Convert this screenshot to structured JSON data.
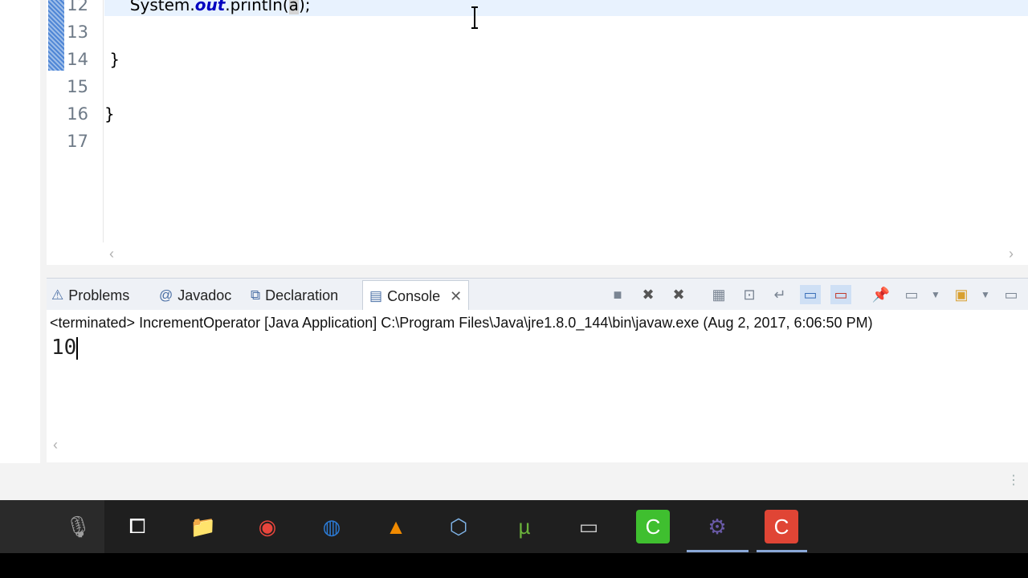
{
  "editor": {
    "lines": [
      {
        "num": "12",
        "parts": [
          {
            "t": "System.",
            "c": ""
          },
          {
            "t": "out",
            "c": "field"
          },
          {
            "t": ".println(",
            "c": ""
          },
          {
            "t": "a",
            "c": "hl"
          },
          {
            "t": ");",
            "c": ""
          }
        ],
        "indent": "     "
      },
      {
        "num": "13",
        "parts": [],
        "indent": ""
      },
      {
        "num": "14",
        "parts": [
          {
            "t": "}",
            "c": ""
          }
        ],
        "indent": " "
      },
      {
        "num": "15",
        "parts": [],
        "indent": ""
      },
      {
        "num": "16",
        "parts": [
          {
            "t": "}",
            "c": ""
          }
        ],
        "indent": ""
      },
      {
        "num": "17",
        "parts": [],
        "indent": ""
      }
    ]
  },
  "console": {
    "tabs": [
      {
        "label": "Problems",
        "icon": "problems-icon",
        "glyph": "⚠"
      },
      {
        "label": "Javadoc",
        "icon": "at-icon",
        "glyph": "@"
      },
      {
        "label": "Declaration",
        "icon": "declaration-icon",
        "glyph": "⧉"
      },
      {
        "label": "Console",
        "icon": "console-icon",
        "glyph": "▤"
      }
    ],
    "terminated_line": "<terminated> IncrementOperator [Java Application] C:\\Program Files\\Java\\jre1.8.0_144\\bin\\javaw.exe (Aug 2, 2017, 6:06:50 PM)",
    "output": "10"
  },
  "taskbar": {
    "apps": [
      {
        "name": "microphone-icon",
        "glyph": "🎙",
        "color": "#9e9e9e"
      },
      {
        "name": "task-view-icon",
        "glyph": "⧠",
        "color": "#ffffff"
      },
      {
        "name": "file-explorer-icon",
        "glyph": "📁",
        "color": "#f2c744"
      },
      {
        "name": "chrome-icon",
        "glyph": "◉",
        "color": "#e8453c"
      },
      {
        "name": "firefox-icon",
        "glyph": "◍",
        "color": "#2b7bd6"
      },
      {
        "name": "vlc-icon",
        "glyph": "▲",
        "color": "#f08a00"
      },
      {
        "name": "virtualbox-icon",
        "glyph": "⬡",
        "color": "#7fb3e6"
      },
      {
        "name": "utorrent-icon",
        "glyph": "µ",
        "color": "#6ab23b"
      },
      {
        "name": "cmd-icon",
        "glyph": "▭",
        "color": "#cccccc"
      },
      {
        "name": "camtasia-green-icon",
        "glyph": "C",
        "color": "#3fbf2f"
      },
      {
        "name": "eclipse-jee-icon",
        "glyph": "⚙",
        "color": "#6a5aa8"
      },
      {
        "name": "camtasia-red-icon",
        "glyph": "C",
        "color": "#e04535"
      }
    ]
  }
}
